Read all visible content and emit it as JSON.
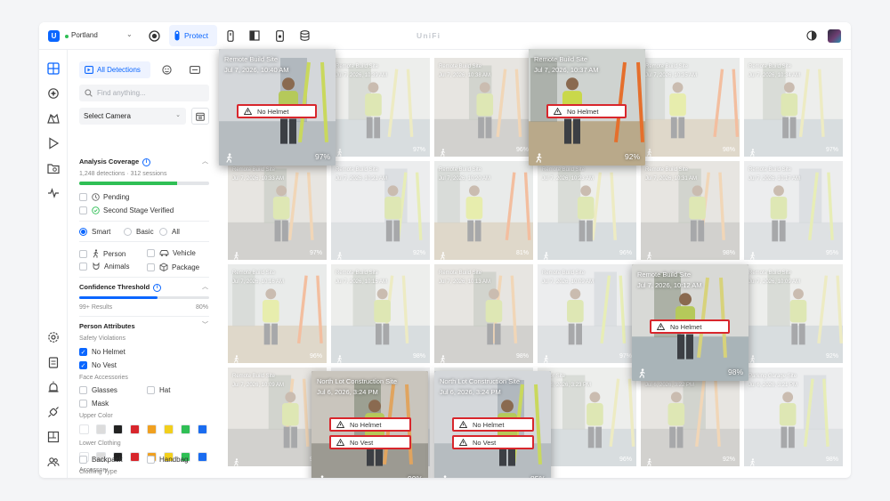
{
  "topbar": {
    "logo_letter": "U",
    "site_name": "Portland",
    "protect_label": "Protect",
    "brand": "UniFi"
  },
  "panel": {
    "all_detections_label": "All Detections",
    "search_placeholder": "Find anything...",
    "camera_select": "Select Camera",
    "analysis_coverage": {
      "title": "Analysis Coverage",
      "stats": "1,248 detections · 312 sessions",
      "coverage_fraction": 0.75,
      "color": "#2fbf55"
    },
    "status_filters": [
      {
        "label": "Pending",
        "checked": false
      },
      {
        "label": "Second Stage Verified",
        "checked": false
      }
    ],
    "modes": [
      {
        "label": "Smart",
        "selected": true
      },
      {
        "label": "Basic",
        "selected": false
      },
      {
        "label": "All",
        "selected": false
      }
    ],
    "object_types": [
      {
        "label": "Person",
        "checked": false
      },
      {
        "label": "Vehicle",
        "checked": false
      },
      {
        "label": "Animals",
        "checked": false
      },
      {
        "label": "Package",
        "checked": false
      }
    ],
    "confidence": {
      "title": "Confidence Threshold",
      "results": "99+ Results",
      "value_label": "80%",
      "value_fraction": 0.6
    },
    "person_attributes": {
      "title": "Person Attributes",
      "safety_title": "Safety Violations",
      "safety": [
        {
          "label": "No Helmet",
          "checked": true
        },
        {
          "label": "No Vest",
          "checked": true
        }
      ],
      "face_title": "Face Accessories",
      "face": [
        {
          "label": "Glasses",
          "checked": false
        },
        {
          "label": "Hat",
          "checked": false
        },
        {
          "label": "Mask",
          "checked": false
        }
      ],
      "upper_title": "Upper Color",
      "lower_title": "Lower Clothing",
      "colors": [
        "#ffffff",
        "#dcdcdc",
        "#222222",
        "#d8262c",
        "#f0a020",
        "#f2cf1c",
        "#2fbf55",
        "#1a6cf0"
      ],
      "accessories_title": "Accessory",
      "accessories": [
        {
          "label": "Backpack",
          "checked": false
        },
        {
          "label": "Handbag",
          "checked": false
        }
      ],
      "clothing_type_title": "Clothing Type"
    }
  },
  "grid": {
    "cells": [
      {
        "cap1": "",
        "cap2": "",
        "pct": ""
      },
      {
        "cap1": "Remote Build Site",
        "cap2": "Jul 7, 2026, 10:39 AM",
        "pct": "97%"
      },
      {
        "cap1": "Remote Build Site",
        "cap2": "Jul 7, 2026, 10:38 AM",
        "pct": "96%"
      },
      {
        "cap1": "",
        "cap2": "",
        "pct": ""
      },
      {
        "cap1": "Remote Build Site",
        "cap2": "Jul 7, 2026, 10:35 AM",
        "pct": "98%"
      },
      {
        "cap1": "Remote Build Site",
        "cap2": "Jul 7, 2026, 10:34 AM",
        "pct": "97%"
      },
      {
        "cap1": "Remote Build Site",
        "cap2": "Jul 7, 2026, 10:33 AM",
        "pct": "97%"
      },
      {
        "cap1": "Remote Build Site",
        "cap2": "Jul 7, 2026, 10:21 AM",
        "pct": "92%"
      },
      {
        "cap1": "Remote Build Site",
        "cap2": "Jul 7, 2026, 10:20 AM",
        "pct": "81%"
      },
      {
        "cap1": "Remote Build Site",
        "cap2": "Jul 7, 2026, 10:23 AM",
        "pct": "96%"
      },
      {
        "cap1": "Remote Build Site",
        "cap2": "Jul 7, 2026, 10:31 AM",
        "pct": "98%"
      },
      {
        "cap1": "Remote Build Site",
        "cap2": "Jul 7, 2026, 10:17 AM",
        "pct": "95%"
      },
      {
        "cap1": "Remote Build Site",
        "cap2": "Jul 7, 2026, 10:16 AM",
        "pct": "96%"
      },
      {
        "cap1": "Remote Build Site",
        "cap2": "Jul 7, 2026, 10:15 AM",
        "pct": "98%"
      },
      {
        "cap1": "Remote Build Site",
        "cap2": "Jul 7, 2026, 10:13 AM",
        "pct": "98%"
      },
      {
        "cap1": "Remote Build Site",
        "cap2": "Jul 7, 2026, 10:09 AM",
        "pct": "97%"
      },
      {
        "cap1": "",
        "cap2": "",
        "pct": ""
      },
      {
        "cap1": "Remote Build Site",
        "cap2": "Jul 7, 2026, 10:09 AM",
        "pct": "92%"
      },
      {
        "cap1": "Remote Build Site",
        "cap2": "Jul 7, 2026, 10:09 AM",
        "pct": "93%"
      },
      {
        "cap1": "",
        "cap2": "",
        "pct": ""
      },
      {
        "cap1": "",
        "cap2": "",
        "pct": ""
      },
      {
        "cap1": "Alder Site",
        "cap2": "Jul 6, 2026, 3:23 PM",
        "pct": "96%"
      },
      {
        "cap1": "SW Alder Site",
        "cap2": "Jul 6, 2026, 3:22 PM",
        "pct": "92%"
      },
      {
        "cap1": "Parking Garage Site",
        "cap2": "Jul 6, 2026, 3:21 PM",
        "pct": "98%"
      }
    ],
    "cards": [
      {
        "site": "Remote Build Site",
        "time": "Jul 7, 2026, 10:40 AM",
        "tags": [
          "No Helmet"
        ],
        "pct": "97%"
      },
      {
        "site": "Remote Build Site",
        "time": "Jul 7, 2026, 10:37 AM",
        "tags": [
          "No Helmet"
        ],
        "pct": "92%"
      },
      {
        "site": "Remote Build Site",
        "time": "Jul 7, 2026, 10:12 AM",
        "tags": [
          "No Helmet"
        ],
        "pct": "98%"
      },
      {
        "site": "North Lot Construction Site",
        "time": "Jul 6, 2026, 3:24 PM",
        "tags": [
          "No Helmet",
          "No Vest"
        ],
        "pct": "90%"
      },
      {
        "site": "North Lot Construction Site",
        "time": "Jul 6, 2026, 3:24 PM",
        "tags": [
          "No Helmet",
          "No Vest"
        ],
        "pct": "85%"
      }
    ]
  }
}
